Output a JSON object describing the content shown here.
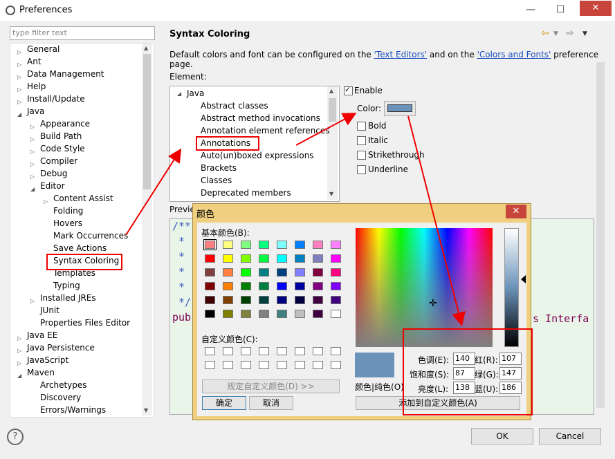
{
  "window": {
    "title": "Preferences",
    "minimize": "—",
    "maximize": "☐",
    "close": "✕"
  },
  "filter": {
    "placeholder": "type filter text"
  },
  "tree": {
    "items": [
      "General",
      "Ant",
      "Data Management",
      "Help",
      "Install/Update",
      "Java",
      "Appearance",
      "Build Path",
      "Code Style",
      "Compiler",
      "Debug",
      "Editor",
      "Content Assist",
      "Folding",
      "Hovers",
      "Mark Occurrences",
      "Save Actions",
      "Syntax Coloring",
      "Templates",
      "Typing",
      "Installed JREs",
      "JUnit",
      "Properties Files Editor",
      "Java EE",
      "Java Persistence",
      "JavaScript",
      "Maven",
      "Archetypes",
      "Discovery",
      "Errors/Warnings"
    ]
  },
  "page": {
    "title": "Syntax Coloring",
    "desc_before": "Default colors and font can be configured on the ",
    "link1": "'Text Editors'",
    "desc_mid": " and on the ",
    "link2": "'Colors and Fonts'",
    "desc_after": " preference page.",
    "element_label": "Element:",
    "elements": [
      "Java",
      "Abstract classes",
      "Abstract method invocations",
      "Annotation element references",
      "Annotations",
      "Auto(un)boxed expressions",
      "Brackets",
      "Classes",
      "Deprecated members"
    ],
    "enable": "Enable",
    "color": "Color:",
    "bold": "Bold",
    "italic": "Italic",
    "strikethrough": "Strikethrough",
    "underline": "Underline",
    "preview_label": "Previe",
    "preview_lines": [
      "/**",
      " *",
      " *",
      " *",
      " *",
      " */",
      "pub"
    ],
    "preview_tail": "s Interfa",
    "swatch_color": "#6b93ba"
  },
  "footer": {
    "ok": "OK",
    "cancel": "Cancel"
  },
  "color_dialog": {
    "title": "颜色",
    "close": "✕",
    "basic_label": "基本颜色(B):",
    "custom_label": "自定义颜色(C):",
    "define_custom": "规定自定义颜色(D) >>",
    "ok": "确定",
    "cancel": "取消",
    "solid_label": "颜色|纯色(O)",
    "add_custom": "添加到自定义颜色(A)",
    "hue_label": "色调(E):",
    "hue": "140",
    "sat_label": "饱和度(S):",
    "sat": "87",
    "lum_label": "亮度(L):",
    "lum": "138",
    "red_label": "红(R):",
    "red": "107",
    "green_label": "绿(G):",
    "green": "147",
    "blue_label": "蓝(U):",
    "blue": "186",
    "basic_colors": [
      "#ff8080",
      "#ffff80",
      "#80ff80",
      "#00ff80",
      "#80ffff",
      "#0080ff",
      "#ff80c0",
      "#ff80ff",
      "#ff0000",
      "#ffff00",
      "#80ff00",
      "#00ff40",
      "#00ffff",
      "#0080c0",
      "#8080c0",
      "#ff00ff",
      "#804040",
      "#ff8040",
      "#00ff00",
      "#008080",
      "#004080",
      "#8080ff",
      "#800040",
      "#ff0080",
      "#800000",
      "#ff8000",
      "#008000",
      "#008040",
      "#0000ff",
      "#0000a0",
      "#800080",
      "#8000ff",
      "#400000",
      "#804000",
      "#004000",
      "#004040",
      "#000080",
      "#000040",
      "#400040",
      "#400080",
      "#000000",
      "#808000",
      "#808040",
      "#808080",
      "#408080",
      "#c0c0c0",
      "#400040",
      "#ffffff"
    ]
  }
}
